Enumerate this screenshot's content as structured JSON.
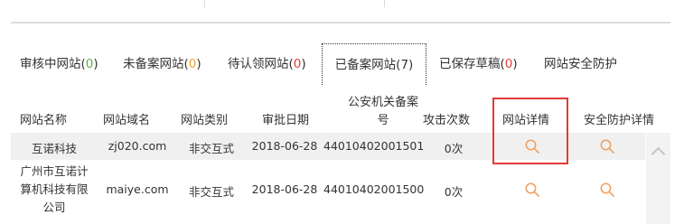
{
  "tabs": [
    {
      "label": "审核中网站",
      "open": "(",
      "count": "0",
      "close": ")",
      "count_color": "green"
    },
    {
      "label": "未备案网站",
      "open": "(",
      "count": "0",
      "close": ")",
      "count_color": "orange"
    },
    {
      "label": "待认领网站",
      "open": "(",
      "count": "0",
      "close": ")",
      "count_color": "red"
    },
    {
      "label": "已备案网站",
      "open": "(",
      "count": "7",
      "close": ")",
      "count_color": "dark",
      "active": true
    },
    {
      "label": "已保存草稿",
      "open": "(",
      "count": "0",
      "close": ")",
      "count_color": "red"
    },
    {
      "label": "网站安全防护"
    }
  ],
  "columns": {
    "name": "网站名称",
    "domain": "网站域名",
    "type": "网站类别",
    "date": "审批日期",
    "police_line1": "公安机关备案",
    "police_line2": "号",
    "attacks": "攻击次数",
    "detail": "网站详情",
    "security": "安全防护详情"
  },
  "rows": [
    {
      "name": "互诺科技",
      "domain": "zj020.com",
      "type": "非交互式",
      "date": "2018-06-28",
      "police_no": "44010402001501",
      "attacks": "0次"
    },
    {
      "name_lines": [
        "广州市互诺计",
        "算机科技有限",
        "公司"
      ],
      "domain": "maiye.com",
      "type": "非交互式",
      "date": "2018-06-28",
      "police_no": "44010402001500",
      "attacks": "0次"
    }
  ],
  "icons": {
    "search": "search-icon",
    "scroll_up": "chevron-up-icon"
  },
  "colors": {
    "count_green": "#61b03a",
    "count_orange": "#f0a22e",
    "count_red": "#e83a32",
    "icon_orange": "#f0a060",
    "highlight_red": "#e53935"
  }
}
